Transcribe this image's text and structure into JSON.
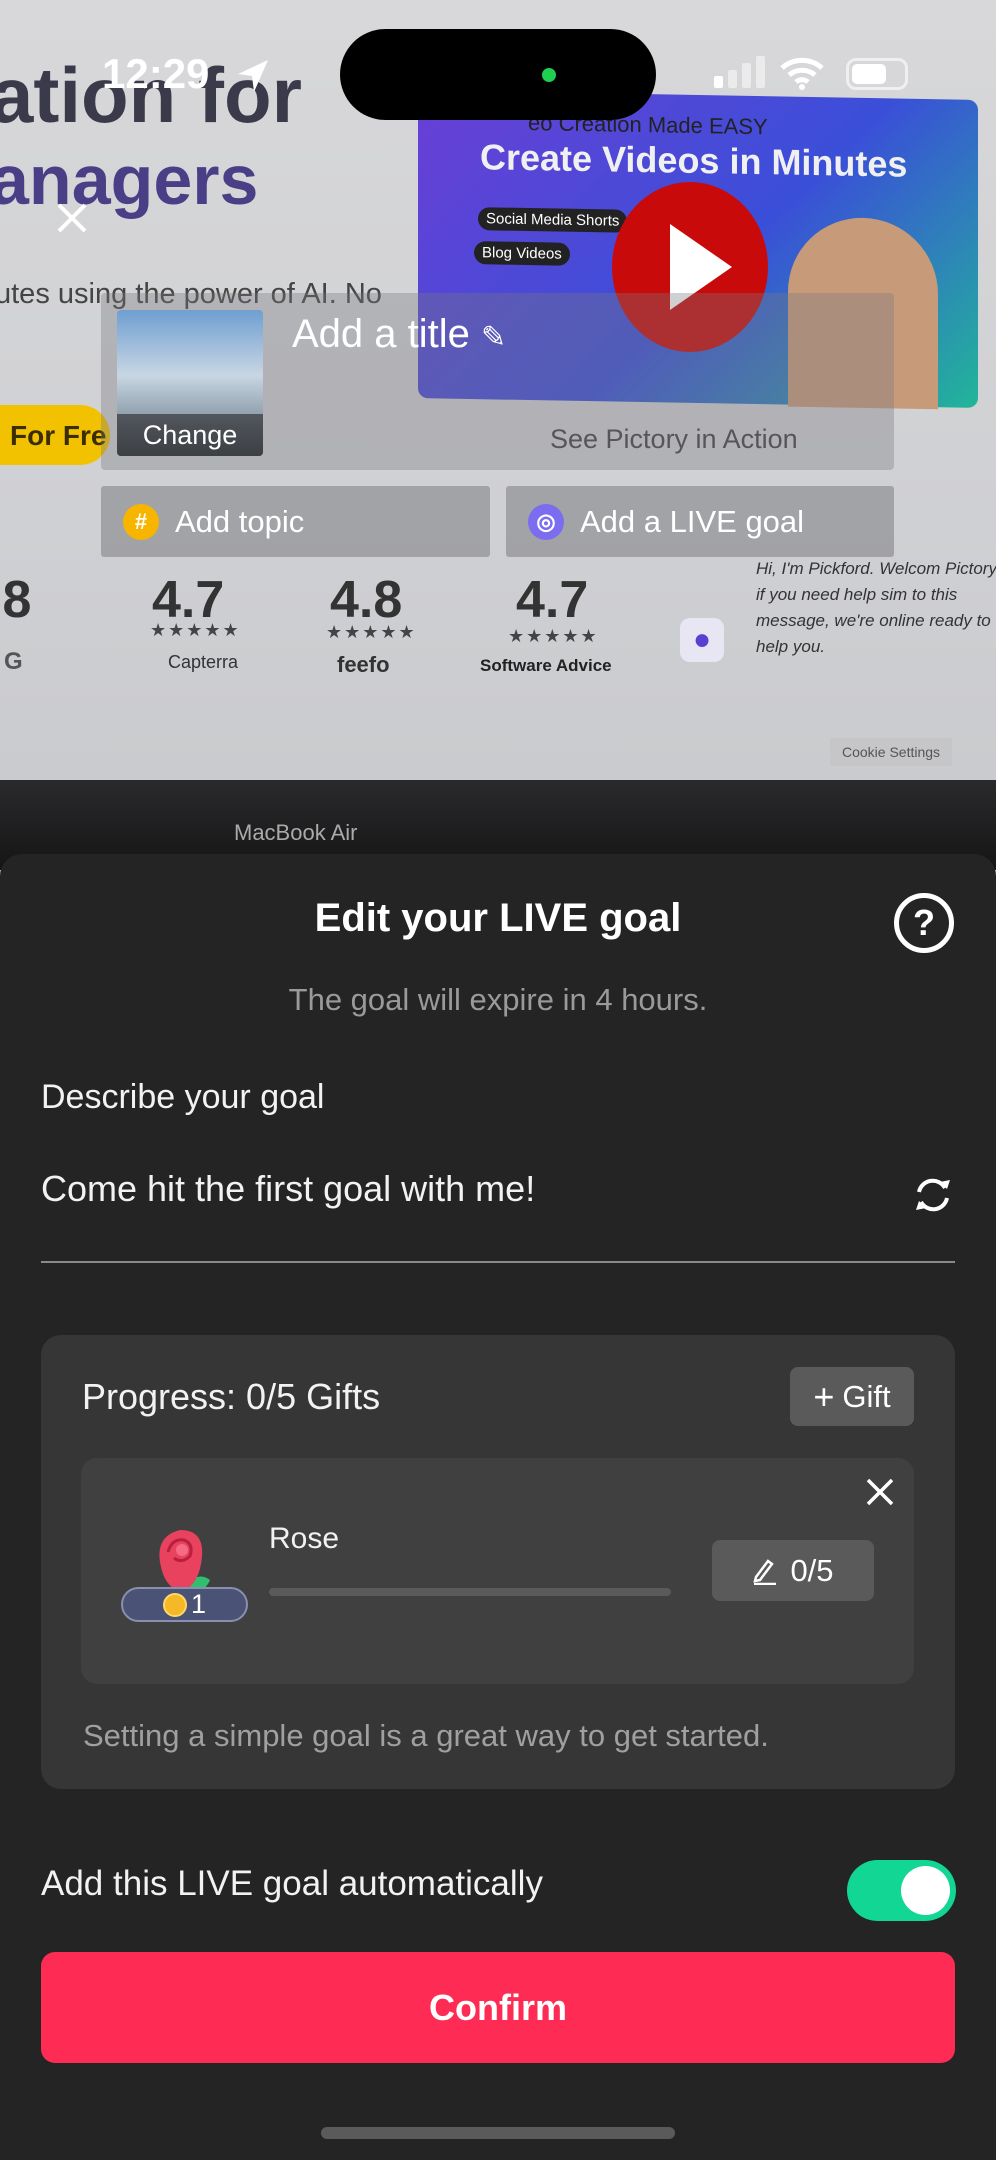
{
  "status_bar": {
    "time": "12:29"
  },
  "camera_background": {
    "headline_line1": "ation for",
    "headline_line2": "anagers",
    "body_text": "utes using the power of AI. No",
    "cta_fragment": "For Fre",
    "video_kicker": "eo Creation Made EASY",
    "video_title": "Create Videos in Minutes",
    "video_tags": [
      "Social Media Shorts",
      "Blog Videos"
    ],
    "video_caption": "See Pictory in Action",
    "ratings": [
      {
        "score": ".8",
        "brand": "G"
      },
      {
        "score": "4.7",
        "brand": "Capterra"
      },
      {
        "score": "4.8",
        "brand": "feefo"
      },
      {
        "score": "4.7",
        "brand": "Software Advice"
      }
    ],
    "chat_text": "Hi, I'm Pickford. Welcom Pictory, if you need help sim to this message, we're online ready to help you.",
    "cookie_button": "Cookie Settings",
    "laptop_label": "MacBook Air"
  },
  "live_setup": {
    "cover_change_label": "Change",
    "title_placeholder": "Add a title",
    "add_topic_label": "Add topic",
    "add_goal_label": "Add a LIVE goal"
  },
  "sheet": {
    "title": "Edit your LIVE goal",
    "subtitle": "The goal will expire in 4 hours.",
    "describe_label": "Describe your goal",
    "goal_text": "Come hit the first goal with me!",
    "progress_label": "Progress: 0/5 Gifts",
    "add_gift_label": "Gift",
    "gift": {
      "name": "Rose",
      "coin_value": "1",
      "count_label": "0/5",
      "progress_fraction": 0
    },
    "hint": "Setting a simple goal is a great way to get started.",
    "auto_add_label": "Add this LIVE goal automatically",
    "auto_add_enabled": true,
    "confirm_label": "Confirm"
  },
  "colors": {
    "accent": "#FE2C55",
    "toggle_on": "#12D694",
    "sheet_bg": "#242424"
  }
}
